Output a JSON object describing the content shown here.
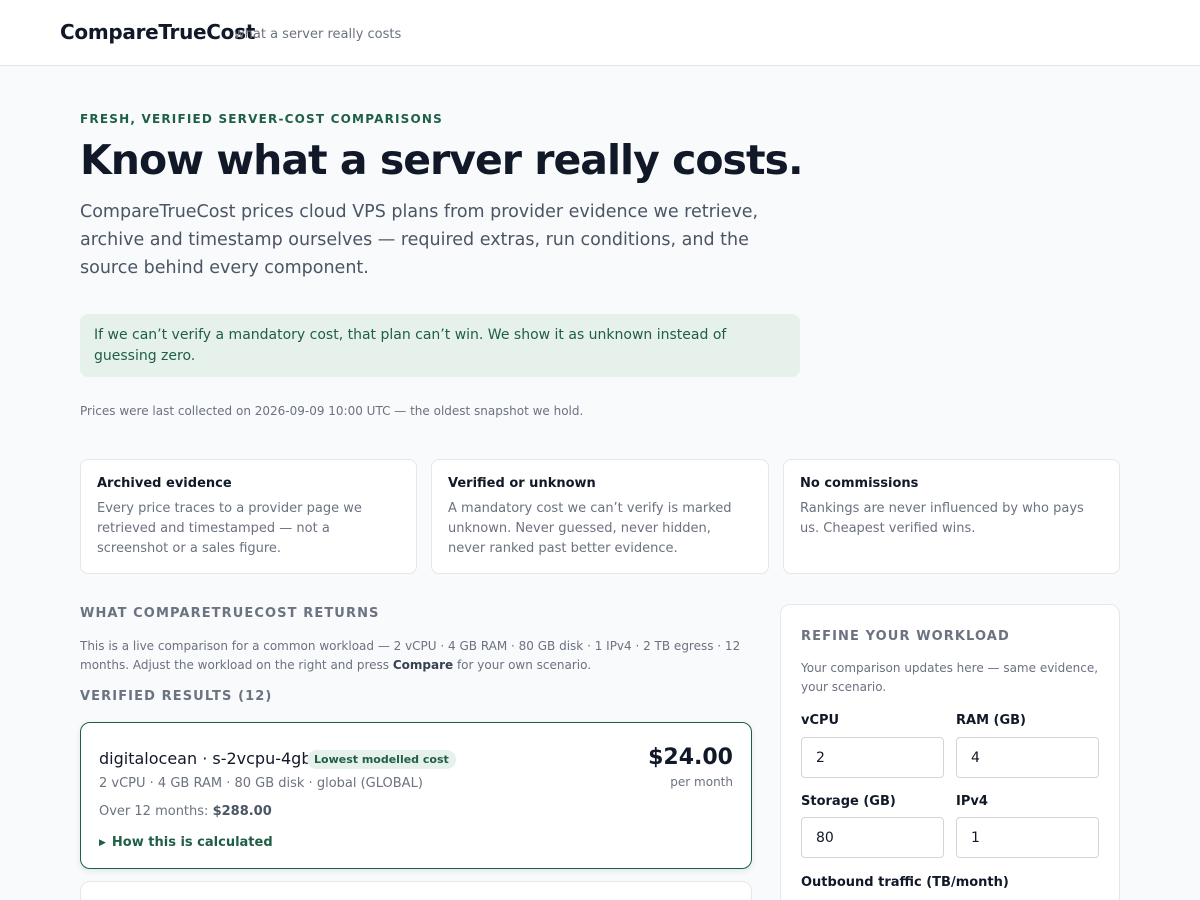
{
  "header": {
    "brand": "CompareTrueCost",
    "tagline": "what a server really costs"
  },
  "hero": {
    "eyebrow": "FRESH, VERIFIED SERVER-COST COMPARISONS",
    "title": "Know what a server really costs.",
    "subtitle": "CompareTrueCost prices cloud VPS plans from provider evidence we retrieve, archive and timestamp ourselves — required extras, run conditions, and the source behind every component.",
    "notice": "If we can’t verify a mandatory cost, that plan can’t win. We show it as unknown instead of guessing zero.",
    "collected": "Prices were last collected on 2026-09-09 10:00 UTC — the oldest snapshot we hold."
  },
  "features": [
    {
      "title": "Archived evidence",
      "body": "Every price traces to a provider page we retrieved and timestamped — not a screenshot or a sales figure."
    },
    {
      "title": "Verified or unknown",
      "body": "A mandatory cost we can’t verify is marked unknown. Never guessed, never hidden, never ranked past better evidence."
    },
    {
      "title": "No commissions",
      "body": "Rankings are never influenced by who pays us. Cheapest verified wins."
    }
  ],
  "returns": {
    "label": "WHAT COMPARETRUECOST RETURNS",
    "note_prefix": "This is a live comparison for a common workload — 2 vCPU · 4 GB RAM · 80 GB disk · 1 IPv4 · 2 TB egress · 12 months. Adjust the workload on the right and press ",
    "note_strong": "Compare",
    "note_suffix": " for your own scenario.",
    "results_label": "VERIFIED RESULTS (12)"
  },
  "results": [
    {
      "title": "digitalocean · s-2vcpu-4gb",
      "badge": "Lowest modelled cost",
      "specs": "2 vCPU · 4 GB RAM · 80 GB disk · global (GLOBAL)",
      "over_label": "Over 12 months: ",
      "over_value": "$288.00",
      "price": "$24.00",
      "price_unit": "per month",
      "calc_label": "How this is calculated"
    }
  ],
  "refine": {
    "title": "REFINE YOUR WORKLOAD",
    "description": "Your comparison updates here — same evidence, your scenario.",
    "fields": {
      "vcpu": {
        "label": "vCPU",
        "value": "2"
      },
      "ram": {
        "label": "RAM (GB)",
        "value": "4"
      },
      "storage": {
        "label": "Storage (GB)",
        "value": "80"
      },
      "ipv4": {
        "label": "IPv4",
        "value": "1"
      },
      "egress": {
        "label": "Outbound traffic (TB/month)"
      }
    }
  },
  "colors": {
    "accent": "#1f5f46",
    "accent_soft": "#e5f1ea",
    "text": "#111827",
    "muted": "#6b7280"
  }
}
